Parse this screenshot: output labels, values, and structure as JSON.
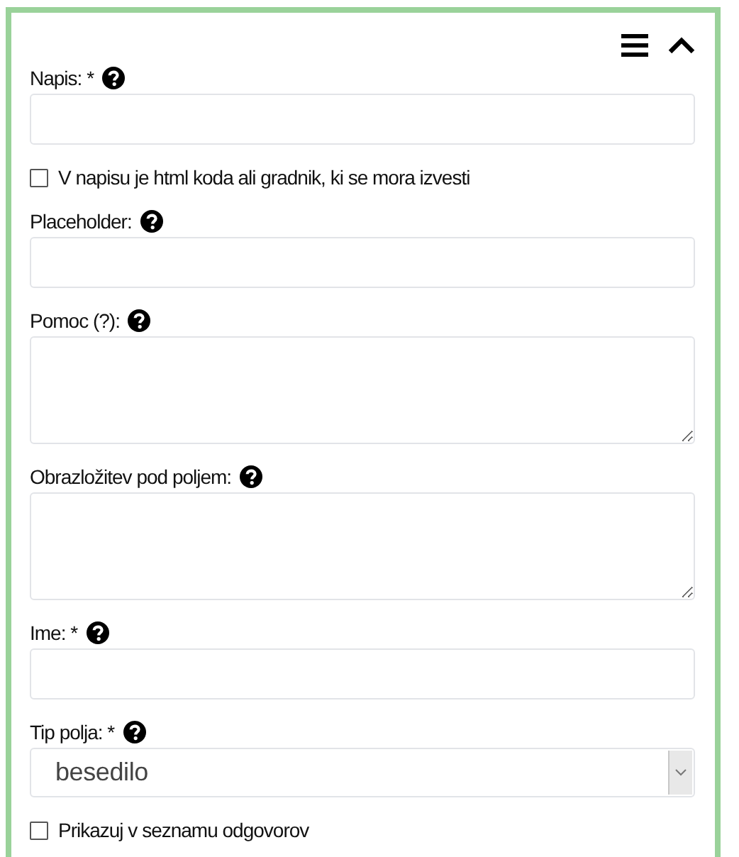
{
  "fields": [
    {
      "kind": "input",
      "label": "Napis: *",
      "help": true
    },
    {
      "kind": "checkbox",
      "label": "V napisu je html koda ali gradnik, ki se mora izvesti",
      "checked": false
    },
    {
      "kind": "input",
      "label": "Placeholder:",
      "help": true
    },
    {
      "kind": "textarea",
      "label": "Pomoc (?):",
      "help": true
    },
    {
      "kind": "textarea",
      "label": "Obrazložitev pod poljem:",
      "help": true
    },
    {
      "kind": "input",
      "label": "Ime: *",
      "help": true
    },
    {
      "kind": "select",
      "label": "Tip polja: *",
      "help": true,
      "value": "besedilo"
    },
    {
      "kind": "checkbox",
      "label": "Prikazuj v seznamu odgovorov",
      "checked": false
    }
  ]
}
